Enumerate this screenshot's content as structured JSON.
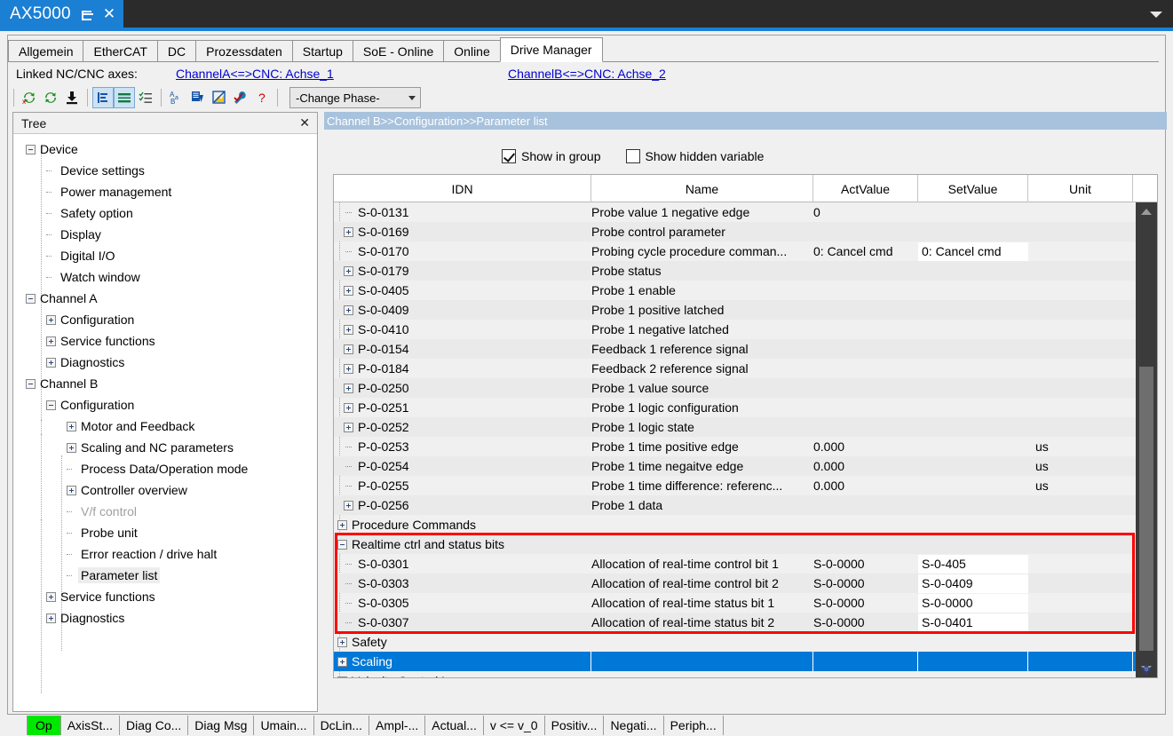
{
  "titlebar": {
    "app_title": "AX5000",
    "pin_icon": "pin-icon",
    "close_icon": "close-icon",
    "dropdown_icon": "caret-down-icon",
    "accent_color": "#1b7fd4",
    "bg_color": "#2b2b2b"
  },
  "tabs": [
    {
      "label": "Allgemein",
      "active": false
    },
    {
      "label": "EtherCAT",
      "active": false
    },
    {
      "label": "DC",
      "active": false
    },
    {
      "label": "Prozessdaten",
      "active": false
    },
    {
      "label": "Startup",
      "active": false
    },
    {
      "label": "SoE - Online",
      "active": false
    },
    {
      "label": "Online",
      "active": false
    },
    {
      "label": "Drive Manager",
      "active": true
    }
  ],
  "linked_axes": {
    "label": "Linked NC/CNC axes:",
    "link_a": "ChannelA<=>CNC: Achse_1",
    "link_b": "ChannelB<=>CNC: Achse_2",
    "link_color": "#0000d0"
  },
  "toolbar": {
    "buttons": [
      {
        "name": "reload-red-icon",
        "glyph": "↺"
      },
      {
        "name": "refresh-green-icon",
        "glyph": "↻"
      },
      {
        "name": "download-icon",
        "glyph": "⬇"
      },
      {
        "name": "tree-view-icon",
        "glyph": "ᴛ",
        "pressed": true
      },
      {
        "name": "list-view-icon",
        "glyph": "≡",
        "pressed": true
      },
      {
        "name": "checklist-icon",
        "glyph": "☰"
      },
      {
        "name": "sort-az-icon",
        "glyph": "A↓"
      },
      {
        "name": "export-down-icon",
        "glyph": "↓"
      },
      {
        "name": "flag-icon",
        "glyph": "⚑"
      },
      {
        "name": "wrench-icon",
        "glyph": "⚒"
      },
      {
        "name": "help-icon",
        "glyph": "?"
      }
    ],
    "phase_combo": {
      "value": "-Change Phase-",
      "chevron": "chevron-down-icon"
    }
  },
  "tree": {
    "title": "Tree",
    "close_icon": "close-icon",
    "nodes": [
      {
        "label": "Device",
        "level": 0,
        "toggle": "minus"
      },
      {
        "label": "Device settings",
        "level": 1,
        "toggle": "leaf"
      },
      {
        "label": "Power management",
        "level": 1,
        "toggle": "leaf"
      },
      {
        "label": "Safety option",
        "level": 1,
        "toggle": "leaf"
      },
      {
        "label": "Display",
        "level": 1,
        "toggle": "leaf"
      },
      {
        "label": "Digital I/O",
        "level": 1,
        "toggle": "leaf"
      },
      {
        "label": "Watch window",
        "level": 1,
        "toggle": "leaf"
      },
      {
        "label": "Channel A",
        "level": 0,
        "toggle": "minus"
      },
      {
        "label": "Configuration",
        "level": 1,
        "toggle": "plus"
      },
      {
        "label": "Service functions",
        "level": 1,
        "toggle": "plus"
      },
      {
        "label": "Diagnostics",
        "level": 1,
        "toggle": "plus"
      },
      {
        "label": "Channel B",
        "level": 0,
        "toggle": "minus"
      },
      {
        "label": "Configuration",
        "level": 1,
        "toggle": "minus"
      },
      {
        "label": "Motor and Feedback",
        "level": 2,
        "toggle": "plus"
      },
      {
        "label": "Scaling and NC parameters",
        "level": 2,
        "toggle": "plus"
      },
      {
        "label": "Process Data/Operation mode",
        "level": 2,
        "toggle": "leaf"
      },
      {
        "label": "Controller overview",
        "level": 2,
        "toggle": "plus"
      },
      {
        "label": "V/f control",
        "level": 2,
        "toggle": "leaf",
        "disabled": true
      },
      {
        "label": "Probe unit",
        "level": 2,
        "toggle": "leaf"
      },
      {
        "label": "Error reaction / drive halt",
        "level": 2,
        "toggle": "leaf"
      },
      {
        "label": "Parameter list",
        "level": 2,
        "toggle": "leaf",
        "selected": true
      },
      {
        "label": "Service functions",
        "level": 1,
        "toggle": "plus"
      },
      {
        "label": "Diagnostics",
        "level": 1,
        "toggle": "plus"
      }
    ]
  },
  "content": {
    "breadcrumb": "Channel B>>Configuration>>Parameter list",
    "checkboxes": [
      {
        "label": "Show in group",
        "checked": true
      },
      {
        "label": "Show hidden variable",
        "checked": false
      }
    ],
    "table": {
      "columns": [
        "IDN",
        "Name",
        "ActValue",
        "SetValue",
        "Unit"
      ],
      "rows": [
        {
          "idn": "S-0-0131",
          "name": "Probe value 1 negative edge",
          "act": "0",
          "set": "",
          "unit": "",
          "toggle": "leaf",
          "indent": 1
        },
        {
          "idn": "S-0-0169",
          "name": "Probe control parameter",
          "act": "",
          "set": "",
          "unit": "",
          "toggle": "plus",
          "indent": 1
        },
        {
          "idn": "S-0-0170",
          "name": "Probing cycle procedure comman...",
          "act": "0: Cancel cmd",
          "set": "0: Cancel cmd",
          "unit": "",
          "toggle": "leaf",
          "indent": 1,
          "set_field": true
        },
        {
          "idn": "S-0-0179",
          "name": "Probe status",
          "act": "",
          "set": "",
          "unit": "",
          "toggle": "plus",
          "indent": 1
        },
        {
          "idn": "S-0-0405",
          "name": "Probe 1 enable",
          "act": "",
          "set": "",
          "unit": "",
          "toggle": "plus",
          "indent": 1
        },
        {
          "idn": "S-0-0409",
          "name": "Probe 1 positive latched",
          "act": "",
          "set": "",
          "unit": "",
          "toggle": "plus",
          "indent": 1
        },
        {
          "idn": "S-0-0410",
          "name": "Probe 1 negative latched",
          "act": "",
          "set": "",
          "unit": "",
          "toggle": "plus",
          "indent": 1
        },
        {
          "idn": "P-0-0154",
          "name": "Feedback 1 reference signal",
          "act": "",
          "set": "",
          "unit": "",
          "toggle": "plus",
          "indent": 1
        },
        {
          "idn": "P-0-0184",
          "name": "Feedback 2 reference signal",
          "act": "",
          "set": "",
          "unit": "",
          "toggle": "plus",
          "indent": 1
        },
        {
          "idn": "P-0-0250",
          "name": "Probe 1 value source",
          "act": "",
          "set": "",
          "unit": "",
          "toggle": "plus",
          "indent": 1
        },
        {
          "idn": "P-0-0251",
          "name": "Probe 1 logic configuration",
          "act": "",
          "set": "",
          "unit": "",
          "toggle": "plus",
          "indent": 1
        },
        {
          "idn": "P-0-0252",
          "name": "Probe 1 logic state",
          "act": "",
          "set": "",
          "unit": "",
          "toggle": "plus",
          "indent": 1
        },
        {
          "idn": "P-0-0253",
          "name": "Probe 1 time positive edge",
          "act": "0.000",
          "set": "",
          "unit": "us",
          "toggle": "leaf",
          "indent": 1
        },
        {
          "idn": "P-0-0254",
          "name": "Probe 1 time negaitve edge",
          "act": "0.000",
          "set": "",
          "unit": "us",
          "toggle": "leaf",
          "indent": 1
        },
        {
          "idn": "P-0-0255",
          "name": "Probe 1 time difference: referenc...",
          "act": "0.000",
          "set": "",
          "unit": "us",
          "toggle": "leaf",
          "indent": 1
        },
        {
          "idn": "P-0-0256",
          "name": "Probe 1 data",
          "act": "",
          "set": "",
          "unit": "",
          "toggle": "plus",
          "indent": 1
        },
        {
          "idn": "Procedure Commands",
          "name": "",
          "act": "",
          "set": "",
          "unit": "",
          "toggle": "plus",
          "indent": 0,
          "group": true
        },
        {
          "idn": "Realtime ctrl and status bits",
          "name": "",
          "act": "",
          "set": "",
          "unit": "",
          "toggle": "minus",
          "indent": 0,
          "group": true
        },
        {
          "idn": "S-0-0301",
          "name": "Allocation of real-time control bit 1",
          "act": "S-0-0000",
          "set": "S-0-405",
          "unit": "",
          "toggle": "leaf",
          "indent": 1,
          "set_field": true
        },
        {
          "idn": "S-0-0303",
          "name": "Allocation of real-time control bit 2",
          "act": "S-0-0000",
          "set": "S-0-0409",
          "unit": "",
          "toggle": "leaf",
          "indent": 1,
          "set_field": true
        },
        {
          "idn": "S-0-0305",
          "name": "Allocation of real-time status bit 1",
          "act": "S-0-0000",
          "set": "S-0-0000",
          "unit": "",
          "toggle": "leaf",
          "indent": 1,
          "set_field": true
        },
        {
          "idn": "S-0-0307",
          "name": "Allocation of real-time status bit 2",
          "act": "S-0-0000",
          "set": "S-0-0401",
          "unit": "",
          "toggle": "leaf",
          "indent": 1,
          "set_field": true
        },
        {
          "idn": "Safety",
          "name": "",
          "act": "",
          "set": "",
          "unit": "",
          "toggle": "plus",
          "indent": 0,
          "group": true
        },
        {
          "idn": "Scaling",
          "name": "",
          "act": "",
          "set": "",
          "unit": "",
          "toggle": "plus",
          "indent": 0,
          "group": true,
          "selected": true
        },
        {
          "idn": "Velocity Control Loop",
          "name": "",
          "act": "",
          "set": "",
          "unit": "",
          "toggle": "plus",
          "indent": 0,
          "group": true
        }
      ],
      "highlight_box": {
        "color": "#ff0000",
        "first_row": 17,
        "last_row": 21
      },
      "selected_row_color": "#0078d7"
    },
    "scrollbar": {
      "up_icon": "scroll-up-arrow-icon",
      "down_icon": "scroll-down-arrow-icon",
      "track_color": "#3b3b3b",
      "thumb_color": "#6e6e6e"
    },
    "resize_grip_icon": "resize-grip-icon"
  },
  "statusbar": {
    "cells": [
      {
        "label": "Op",
        "highlight": true
      },
      {
        "label": "AxisSt..."
      },
      {
        "label": "Diag Co..."
      },
      {
        "label": "Diag Msg"
      },
      {
        "label": "Umain..."
      },
      {
        "label": "DcLin..."
      },
      {
        "label": "Ampl-..."
      },
      {
        "label": "Actual..."
      },
      {
        "label": "v <= v_0"
      },
      {
        "label": "Positiv..."
      },
      {
        "label": "Negati..."
      },
      {
        "label": "Periph..."
      }
    ],
    "highlight_color": "#00e800"
  }
}
